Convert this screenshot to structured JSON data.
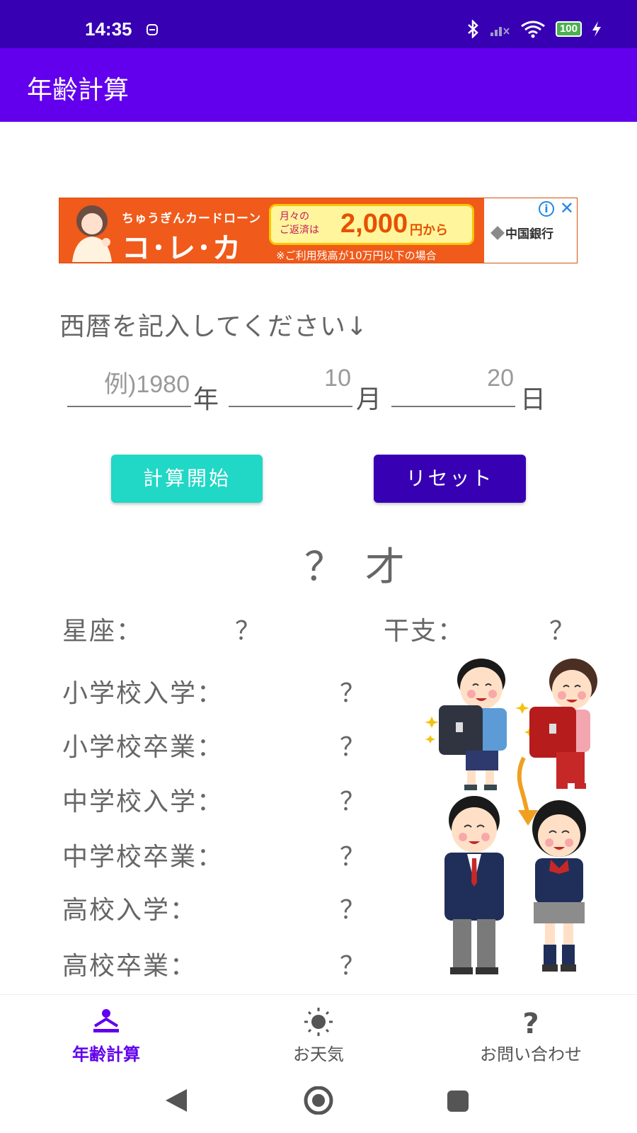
{
  "status_bar": {
    "time": "14:35",
    "battery": "100"
  },
  "app_bar": {
    "title": "年齢計算"
  },
  "ad": {
    "top_text": "ちゅうぎんカードローン",
    "logo_text": "コ･レ･カ",
    "box_small_line1": "月々の",
    "box_small_line2": "ご返済は",
    "box_amount": "2,000",
    "box_unit": "円から",
    "note": "※ご利用残高が10万円以下の場合",
    "bank_name": "中国銀行",
    "info_icon": "info-icon",
    "close_icon": "close-icon"
  },
  "form": {
    "prompt": "西暦を記入してください↓",
    "year_placeholder": "例)1980",
    "year_unit": "年",
    "month_value": "10",
    "month_unit": "月",
    "day_value": "20",
    "day_unit": "日"
  },
  "buttons": {
    "calc_label": "計算開始",
    "reset_label": "リセット",
    "calc_color": "#21d7c6",
    "reset_color": "#3700b3"
  },
  "result": {
    "age": "？ 才",
    "zodiac_label": "星座：",
    "zodiac_value": "？",
    "eto_label": "干支：",
    "eto_value": "？",
    "milestones": [
      {
        "label": "小学校入学：",
        "value": "？"
      },
      {
        "label": "小学校卒業：",
        "value": "？"
      },
      {
        "label": "中学校入学：",
        "value": "？"
      },
      {
        "label": "中学校卒業：",
        "value": "？"
      },
      {
        "label": "高校入学：",
        "value": "？"
      },
      {
        "label": "高校卒業：",
        "value": "？"
      }
    ]
  },
  "bottom_nav": {
    "items": [
      {
        "label": "年齢計算",
        "icon": "person-icon",
        "active": true
      },
      {
        "label": "お天気",
        "icon": "sun-icon",
        "active": false
      },
      {
        "label": "お問い合わせ",
        "icon": "question-icon",
        "active": false
      }
    ],
    "active_color": "#6200ee",
    "inactive_color": "#555555"
  },
  "colors": {
    "status_bar": "#3700b3",
    "app_bar": "#6200ee"
  }
}
